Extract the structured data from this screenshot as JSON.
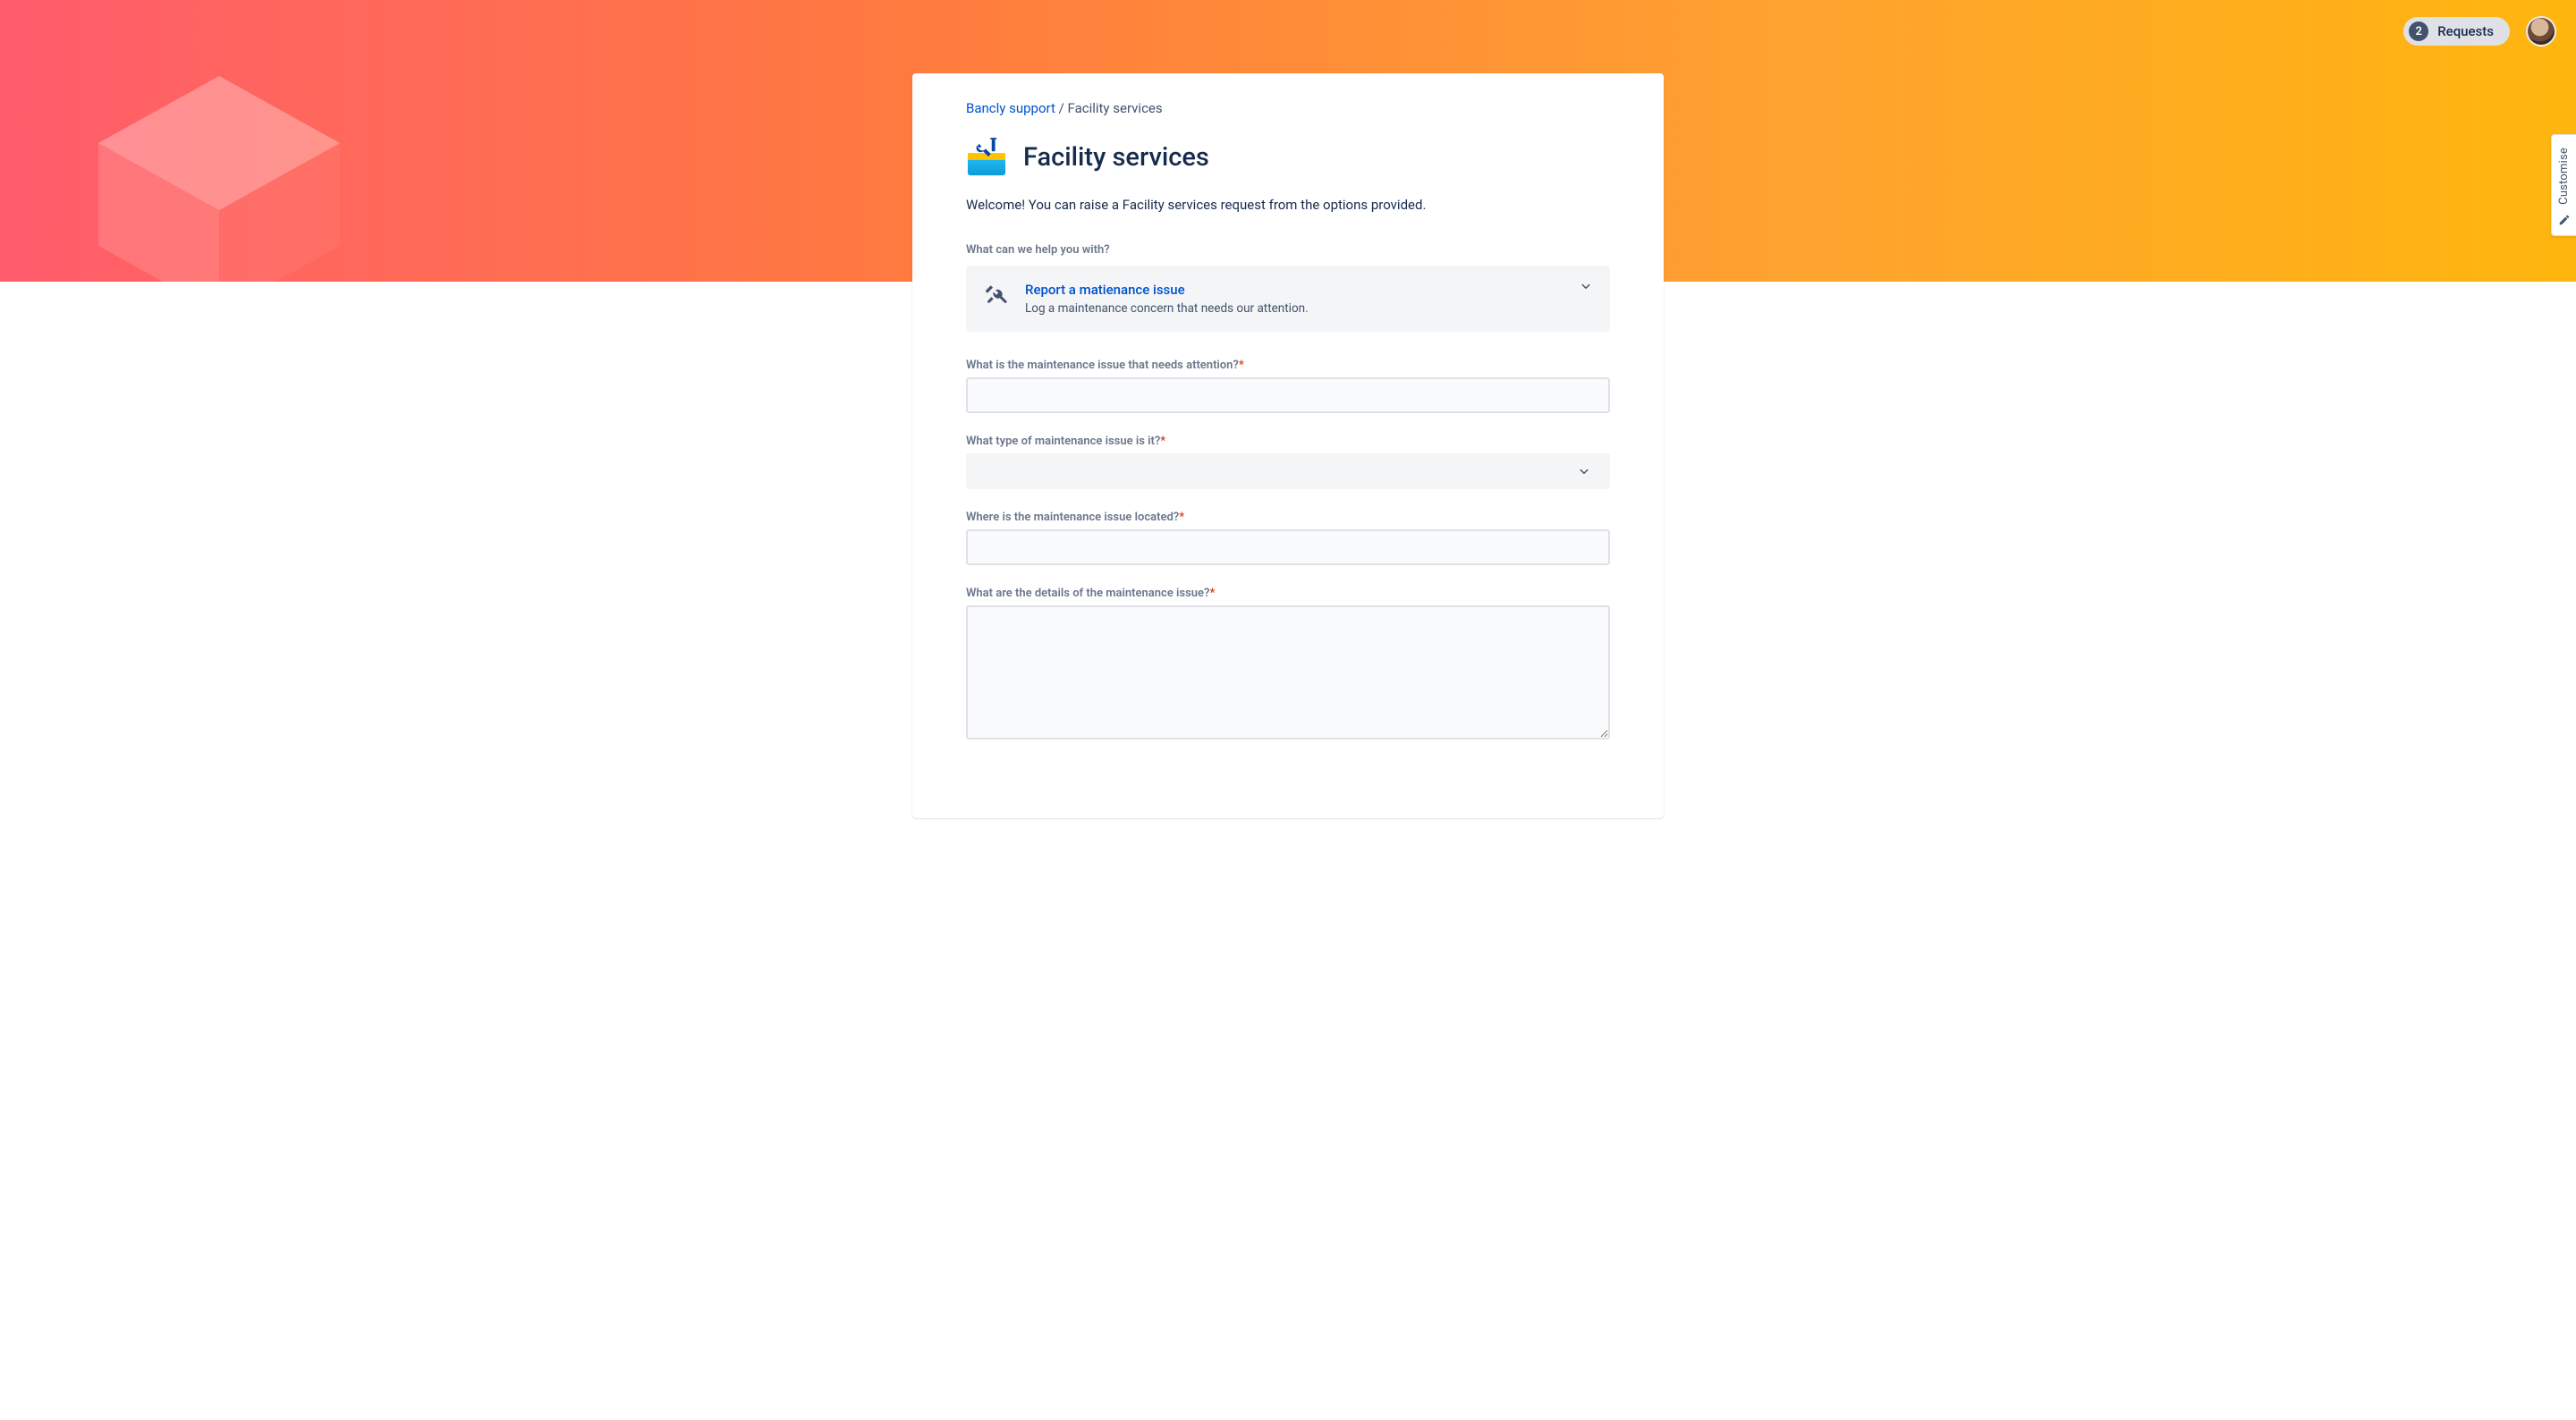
{
  "topbar": {
    "requests_count": "2",
    "requests_label": "Requests"
  },
  "customise": {
    "label": "Customise"
  },
  "breadcrumb": {
    "root": "Bancly support",
    "separator": "/",
    "current": "Facility services"
  },
  "page": {
    "title": "Facility services",
    "welcome": "Welcome! You can raise a Facility services request from the options provided."
  },
  "help_prompt": "What can we help you with?",
  "request_type": {
    "title": "Report a matienance issue",
    "description": "Log a maintenance concern that needs our attention."
  },
  "fields": {
    "issue": {
      "label": "What is the maintenance issue that needs attention?",
      "value": ""
    },
    "type": {
      "label": "What type of maintenance issue is it?",
      "value": ""
    },
    "location": {
      "label": "Where is the maintenance issue located?",
      "value": ""
    },
    "details": {
      "label": "What are the details of the maintenance issue?",
      "value": ""
    }
  }
}
